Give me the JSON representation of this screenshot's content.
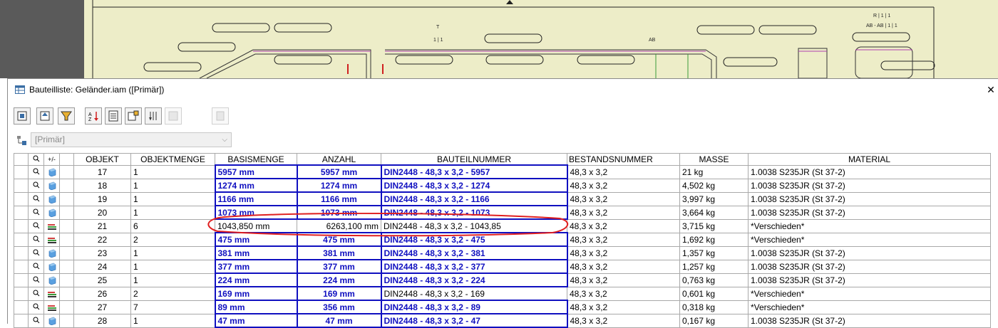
{
  "title": "Bauteilliste: Geländer.iam ([Primär])",
  "view_select": {
    "value": "[Primär]"
  },
  "cad": {
    "labels": [
      "T",
      "1 | 1",
      "R | 1 | 1",
      "AB",
      "AB - AB | 1 | 1"
    ]
  },
  "columns": [
    "",
    "",
    "",
    "",
    "OBJEKT",
    "OBJEKTMENGE",
    "BASISMENGE",
    "ANZAHL",
    "BAUTEILNUMMER",
    "BESTANDSNUMMER",
    "MASSE",
    "MATERIAL"
  ],
  "rows": [
    {
      "type": "part",
      "objekt": "17",
      "menge": "1",
      "basis": "5957 mm",
      "anzahl": "5957 mm",
      "nummer": "DIN2448 - 48,3 x 3,2 - 5957",
      "bestand": "48,3 x 3,2",
      "masse": "21 kg",
      "material": "1.0038 S235JR (St 37-2)",
      "hl": true
    },
    {
      "type": "part",
      "objekt": "18",
      "menge": "1",
      "basis": "1274 mm",
      "anzahl": "1274 mm",
      "nummer": "DIN2448 - 48,3 x 3,2 - 1274",
      "bestand": "48,3 x 3,2",
      "masse": "4,502 kg",
      "material": "1.0038 S235JR (St 37-2)",
      "hl": true
    },
    {
      "type": "part",
      "objekt": "19",
      "menge": "1",
      "basis": "1166 mm",
      "anzahl": "1166 mm",
      "nummer": "DIN2448 - 48,3 x 3,2 - 1166",
      "bestand": "48,3 x 3,2",
      "masse": "3,997 kg",
      "material": "1.0038 S235JR (St 37-2)",
      "hl": true
    },
    {
      "type": "part",
      "objekt": "20",
      "menge": "1",
      "basis": "1073 mm",
      "anzahl": "1073 mm",
      "nummer": "DIN2448 - 48,3 x 3,2 - 1073",
      "bestand": "48,3 x 3,2",
      "masse": "3,664 kg",
      "material": "1.0038 S235JR (St 37-2)",
      "hl": true
    },
    {
      "type": "asm",
      "objekt": "21",
      "menge": "6",
      "basis": "1043,850 mm",
      "anzahl": "6263,100 mm",
      "nummer": "DIN2448 - 48,3 x 3,2 - 1043,85",
      "bestand": "48,3 x 3,2",
      "masse": "3,715 kg",
      "material": "*Verschieden*",
      "hl": false
    },
    {
      "type": "asm",
      "objekt": "22",
      "menge": "2",
      "basis": "475 mm",
      "anzahl": "475 mm",
      "nummer": "DIN2448 - 48,3 x 3,2 - 475",
      "bestand": "48,3 x 3,2",
      "masse": "1,692 kg",
      "material": "*Verschieden*",
      "hl": true
    },
    {
      "type": "part",
      "objekt": "23",
      "menge": "1",
      "basis": "381 mm",
      "anzahl": "381 mm",
      "nummer": "DIN2448 - 48,3 x 3,2 - 381",
      "bestand": "48,3 x 3,2",
      "masse": "1,357 kg",
      "material": "1.0038 S235JR (St 37-2)",
      "hl": true
    },
    {
      "type": "part",
      "objekt": "24",
      "menge": "1",
      "basis": "377 mm",
      "anzahl": "377 mm",
      "nummer": "DIN2448 - 48,3 x 3,2 - 377",
      "bestand": "48,3 x 3,2",
      "masse": "1,257 kg",
      "material": "1.0038 S235JR (St 37-2)",
      "hl": true
    },
    {
      "type": "part",
      "objekt": "25",
      "menge": "1",
      "basis": "224 mm",
      "anzahl": "224 mm",
      "nummer": "DIN2448 - 48,3 x 3,2 - 224",
      "bestand": "48,3 x 3,2",
      "masse": "0,763 kg",
      "material": "1.0038 S235JR (St 37-2)",
      "hl": true
    },
    {
      "type": "asm",
      "objekt": "26",
      "menge": "2",
      "basis": "169 mm",
      "anzahl": "169 mm",
      "nummer": "DIN2448 - 48,3 x 3,2 - 169",
      "bestand": "48,3 x 3,2",
      "masse": "0,601 kg",
      "material": "*Verschieden*",
      "hl": true,
      "nummer_plain": true
    },
    {
      "type": "asm",
      "objekt": "27",
      "menge": "7",
      "basis": "89 mm",
      "anzahl": "356 mm",
      "nummer": "DIN2448 - 48,3 x 3,2 - 89",
      "bestand": "48,3 x 3,2",
      "masse": "0,318 kg",
      "material": "*Verschieden*",
      "hl": true
    },
    {
      "type": "part",
      "objekt": "28",
      "menge": "1",
      "basis": "47 mm",
      "anzahl": "47 mm",
      "nummer": "DIN2448 - 48,3 x 3,2 - 47",
      "bestand": "48,3 x 3,2",
      "masse": "0,167 kg",
      "material": "1.0038 S235JR (St 37-2)",
      "hl": true
    }
  ],
  "icons": {
    "title": "table-icon",
    "row_find": "magnifier-icon",
    "part": "part-cube-icon",
    "asm": "assembly-icon"
  },
  "colors": {
    "highlight_border": "#1010c0",
    "part_icon": "#4a90d9",
    "annotation_red": "#e02020"
  }
}
